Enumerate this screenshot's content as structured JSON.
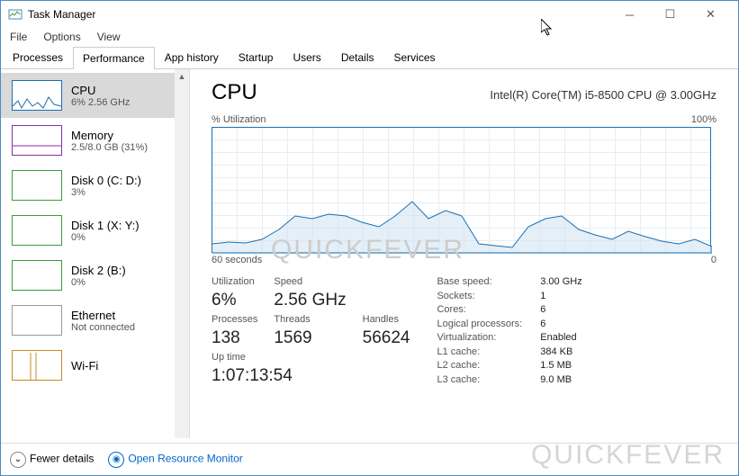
{
  "window": {
    "title": "Task Manager"
  },
  "menu": {
    "file": "File",
    "options": "Options",
    "view": "View"
  },
  "tabs": {
    "processes": "Processes",
    "performance": "Performance",
    "apphistory": "App history",
    "startup": "Startup",
    "users": "Users",
    "details": "Details",
    "services": "Services"
  },
  "sidebar": {
    "items": [
      {
        "title": "CPU",
        "sub": "6% 2.56 GHz"
      },
      {
        "title": "Memory",
        "sub": "2.5/8.0 GB (31%)"
      },
      {
        "title": "Disk 0 (C: D:)",
        "sub": "3%"
      },
      {
        "title": "Disk 1 (X: Y:)",
        "sub": "0%"
      },
      {
        "title": "Disk 2 (B:)",
        "sub": "0%"
      },
      {
        "title": "Ethernet",
        "sub": "Not connected"
      },
      {
        "title": "Wi-Fi",
        "sub": ""
      }
    ]
  },
  "main": {
    "title": "CPU",
    "model": "Intel(R) Core(TM) i5-8500 CPU @ 3.00GHz",
    "chart_top_left": "% Utilization",
    "chart_top_right": "100%",
    "chart_bot_left": "60 seconds",
    "chart_bot_right": "0",
    "stats": {
      "util_label": "Utilization",
      "util": "6%",
      "speed_label": "Speed",
      "speed": "2.56 GHz",
      "proc_label": "Processes",
      "proc": "138",
      "threads_label": "Threads",
      "threads": "1569",
      "handles_label": "Handles",
      "handles": "56624",
      "uptime_label": "Up time",
      "uptime": "1:07:13:54"
    },
    "right": {
      "base_k": "Base speed:",
      "base_v": "3.00 GHz",
      "sock_k": "Sockets:",
      "sock_v": "1",
      "cores_k": "Cores:",
      "cores_v": "6",
      "lp_k": "Logical processors:",
      "lp_v": "6",
      "virt_k": "Virtualization:",
      "virt_v": "Enabled",
      "l1_k": "L1 cache:",
      "l1_v": "384 KB",
      "l2_k": "L2 cache:",
      "l2_v": "1.5 MB",
      "l3_k": "L3 cache:",
      "l3_v": "9.0 MB"
    }
  },
  "footer": {
    "fewer": "Fewer details",
    "orm": "Open Resource Monitor"
  },
  "watermark": "QUICKFEVER",
  "chart_data": {
    "type": "line",
    "title": "% Utilization",
    "ylabel": "% Utilization",
    "xlabel": "seconds",
    "ylim": [
      0,
      100
    ],
    "xlim": [
      60,
      0
    ],
    "x": [
      60,
      58,
      56,
      54,
      52,
      50,
      48,
      46,
      44,
      42,
      40,
      38,
      36,
      34,
      32,
      30,
      28,
      26,
      24,
      22,
      20,
      18,
      16,
      14,
      12,
      10,
      8,
      6,
      4,
      2,
      0
    ],
    "values": [
      8,
      10,
      9,
      12,
      20,
      30,
      28,
      32,
      30,
      25,
      22,
      30,
      42,
      28,
      35,
      30,
      8,
      6,
      5,
      22,
      28,
      30,
      20,
      15,
      12,
      18,
      14,
      10,
      8,
      12,
      6
    ]
  }
}
